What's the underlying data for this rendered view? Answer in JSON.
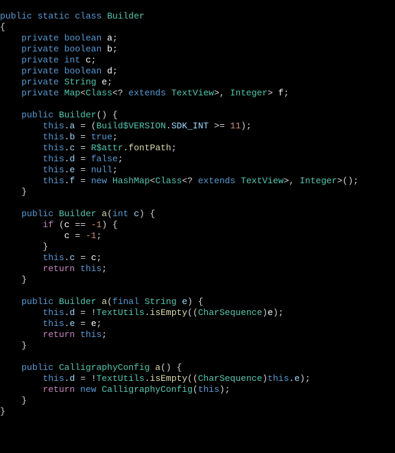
{
  "code": {
    "line1": {
      "public": "public",
      "static": "static",
      "class": "class",
      "name": "Builder"
    },
    "line2": {
      "brace": "{"
    },
    "fields": {
      "a": {
        "mod": "private",
        "type": "boolean",
        "name": "a"
      },
      "b": {
        "mod": "private",
        "type": "boolean",
        "name": "b"
      },
      "c": {
        "mod": "private",
        "type": "int",
        "name": "c"
      },
      "d": {
        "mod": "private",
        "type": "boolean",
        "name": "d"
      },
      "e": {
        "mod": "private",
        "type": "String",
        "name": "e"
      },
      "f": {
        "mod": "private",
        "type1": "Map",
        "type2": "Class",
        "ext": "extends",
        "type3": "TextView",
        "type4": "Integer",
        "name": "f"
      }
    },
    "ctor": {
      "mod": "public",
      "name": "Builder",
      "l1": {
        "this": "this",
        "dot": ".",
        "field": "a",
        "eq": "=",
        "lp": "(",
        "build": "Build$VERSION",
        "dot2": ".",
        "sdk": "SDK_INT",
        "op": ">=",
        "num": "11",
        "rp": ")",
        "semi": ";"
      },
      "l2": {
        "this": "this",
        "field": "b",
        "val": "true"
      },
      "l3": {
        "this": "this",
        "field": "c",
        "cls": "R$attr",
        "prop": "fontPath"
      },
      "l4": {
        "this": "this",
        "field": "d",
        "val": "false"
      },
      "l5": {
        "this": "this",
        "field": "e",
        "val": "null"
      },
      "l6": {
        "this": "this",
        "field": "f",
        "new": "new",
        "type1": "HashMap",
        "type2": "Class",
        "ext": "extends",
        "type3": "TextView",
        "type4": "Integer"
      }
    },
    "m1": {
      "mod": "public",
      "ret": "Builder",
      "name": "a",
      "ptype": "int",
      "pname": "c",
      "if": "if",
      "var": "c",
      "op": "==",
      "neg": "-1",
      "assign": {
        "var": "c",
        "val": "-1"
      },
      "set": {
        "this": "this",
        "field": "c",
        "var": "c"
      },
      "return": "return",
      "this": "this"
    },
    "m2": {
      "mod": "public",
      "ret": "Builder",
      "name": "a",
      "final": "final",
      "ptype": "String",
      "pname": "e",
      "l1": {
        "this": "this",
        "field": "d",
        "bang": "!",
        "cls": "TextUtils",
        "method": "isEmpty",
        "cast": "CharSequence",
        "var": "e"
      },
      "l2": {
        "this": "this",
        "field": "e",
        "var": "e"
      },
      "return": "return",
      "this": "this"
    },
    "m3": {
      "mod": "public",
      "ret": "CalligraphyConfig",
      "name": "a",
      "l1": {
        "this": "this",
        "field": "d",
        "bang": "!",
        "cls": "TextUtils",
        "method": "isEmpty",
        "cast": "CharSequence",
        "this2": "this",
        "field2": "e"
      },
      "return": "return",
      "new": "new",
      "type": "CalligraphyConfig",
      "this": "this"
    }
  }
}
